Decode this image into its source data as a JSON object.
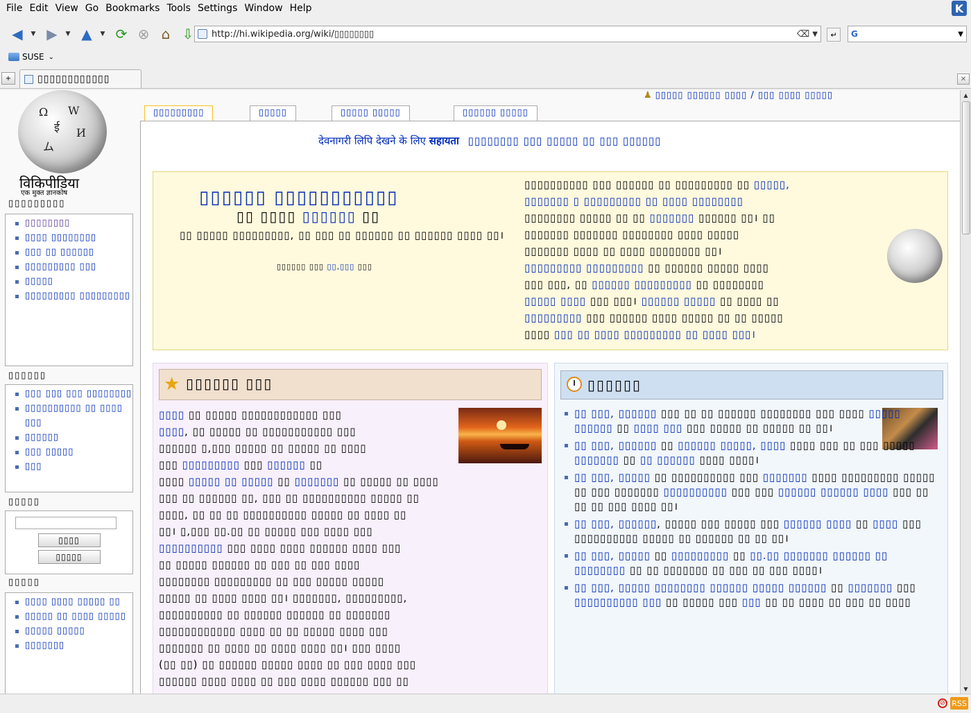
{
  "menubar": {
    "items": [
      "File",
      "Edit",
      "View",
      "Go",
      "Bookmarks",
      "Tools",
      "Settings",
      "Window",
      "Help"
    ],
    "logo_icon": "kde-logo-icon"
  },
  "toolbar": {
    "icons": [
      "back-icon",
      "forward-icon",
      "up-icon",
      "reload-icon",
      "stop-icon",
      "home-icon",
      "download-icon"
    ]
  },
  "address": {
    "url": "http://hi.wikipedia.org/wiki/▯▯▯▯▯▯▯▯"
  },
  "bookmarks": {
    "folder_label": "SUSE"
  },
  "tabs": [
    {
      "label": "▯▯▯▯▯▯▯▯▯▯▯▯"
    }
  ],
  "wiki_logo": {
    "wordmark": "विकिपीडिया",
    "tagline": "एक मुक्त ज्ञानकोष"
  },
  "sidebar": {
    "navigation": {
      "title": "▯▯▯▯▯▯▯▯▯",
      "items": [
        "▯▯▯▯▯▯▯▯",
        "▯▯▯▯ ▯▯▯▯▯▯▯▯",
        "▯▯▯ ▯▯ ▯▯▯▯▯▯",
        "▯▯▯▯▯▯▯▯▯ ▯▯▯",
        "▯▯▯▯▯",
        "▯▯▯▯▯▯▯▯▯ ▯▯▯▯▯▯▯▯▯"
      ]
    },
    "interaction": {
      "title": "▯▯▯▯▯▯",
      "items": [
        "▯▯▯ ▯▯▯ ▯▯▯ ▯▯▯▯▯▯▯▯",
        "▯▯▯▯▯▯▯▯▯▯ ▯▯ ▯▯▯▯ ▯▯▯",
        "▯▯▯▯▯▯",
        "▯▯▯ ▯▯▯▯▯",
        "▯▯▯"
      ]
    },
    "search": {
      "title": "▯▯▯▯▯",
      "go_label": "▯▯▯▯",
      "search_label": "▯▯▯▯▯"
    },
    "toolbox": {
      "title": "▯▯▯▯▯",
      "items": [
        "▯▯▯▯ ▯▯▯▯ ▯▯▯▯▯ ▯▯",
        "▯▯▯▯▯ ▯▯ ▯▯▯▯ ▯▯▯▯▯",
        "▯▯▯▯▯ ▯▯▯▯▯",
        "▯▯▯▯▯▯▯"
      ]
    }
  },
  "personal_tools": {
    "label": "▯▯▯▯▯ ▯▯▯▯▯▯ ▯▯▯▯ / ▯▯▯ ▯▯▯▯ ▯▯▯▯▯"
  },
  "content_tabs": [
    "▯▯▯▯▯▯▯▯▯",
    "▯▯▯▯▯",
    "▯▯▯▯▯ ▯▯▯▯▯",
    "▯▯▯▯▯▯ ▯▯▯▯▯"
  ],
  "help_line": {
    "prefix": "देवनागरी लिपि देखने के लिए",
    "strong": "सहायता",
    "suffix": "▯▯▯▯▯▯▯▯ ▯▯▯ ▯▯▯▯▯ ▯▯ ▯▯▯ ▯▯▯▯▯▯"
  },
  "welcome": {
    "title": "▯▯▯▯▯▯ ▯▯▯▯▯▯▯▯▯▯▯",
    "sub_pre": "▯▯ ▯▯▯▯",
    "sub_link": "▯▯▯▯▯▯",
    "sub_post": "▯▯",
    "description": "▯▯ ▯▯▯▯▯ ▯▯▯▯▯▯▯▯▯, ▯▯ ▯▯▯ ▯▯ ▯▯▯▯▯▯ ▯▯ ▯▯▯▯▯▯ ▯▯▯▯ ▯▯।",
    "stats_pre": "▯▯▯▯▯▯ ▯▯▯",
    "stats_link": "▯▯,▯▯▯",
    "stats_post": "▯▯▯",
    "right_1": "▯▯▯▯▯▯▯▯▯▯ ▯▯▯ ▯▯▯▯▯▯ ▯▯ ▯▯▯▯▯▯▯▯▯ ▯▯",
    "right_1_link": "▯▯▯▯▯,",
    "right_2_link": "▯▯▯▯▯▯▯ ▯ ▯▯▯▯▯▯▯▯▯ ▯▯ ▯▯▯▯ ▯▯▯▯▯▯▯▯",
    "right_3": "▯▯▯▯▯▯▯▯ ▯▯▯▯▯ ▯▯ ▯▯",
    "right_3_link": "▯▯▯▯▯▯▯",
    "right_3_end": "▯▯▯▯▯▯ ▯▯। ▯▯",
    "right_4": "▯▯▯▯▯▯▯ ▯▯▯▯▯▯▯ ▯▯▯▯▯▯▯▯ ▯▯▯▯ ▯▯▯▯▯",
    "right_5": "▯▯▯▯▯▯▯ ▯▯▯▯ ▯▯ ▯▯▯▯ ▯▯▯▯▯▯▯▯ ▯▯।",
    "right_6_link": "▯▯▯▯▯▯▯▯▯ ▯▯▯▯▯▯▯▯▯",
    "right_6": "▯▯ ▯▯▯▯▯▯ ▯▯▯▯▯ ▯▯▯▯",
    "right_7": "▯▯▯ ▯▯▯, ▯▯",
    "right_7_link": "▯▯▯▯▯▯ ▯▯▯▯▯▯▯▯▯",
    "right_7_end": "▯▯ ▯▯▯▯▯▯▯▯",
    "right_8_link": "▯▯▯▯▯ ▯▯▯▯",
    "right_8": "▯▯▯ ▯▯▯।",
    "right_8_link2": "▯▯▯▯▯▯ ▯▯▯▯▯",
    "right_8_end": "▯▯ ▯▯▯▯ ▯▯",
    "right_9_link": "▯▯▯▯▯▯▯▯▯",
    "right_9": "▯▯▯ ▯▯▯▯▯▯ ▯▯▯▯ ▯▯▯▯▯ ▯▯ ▯▯ ▯▯▯▯▯",
    "right_10": "▯▯▯▯",
    "right_10_link": "▯▯▯ ▯▯ ▯▯▯▯ ▯▯▯▯▯▯▯▯▯ ▯▯ ▯▯▯▯ ▯▯▯।"
  },
  "featured": {
    "title": "▯▯▯▯▯▯ ▯▯▯",
    "lines": [
      [
        "l",
        "▯▯▯▯",
        "t",
        " ▯▯ ▯▯▯▯▯ ▯▯▯▯▯▯▯▯▯▯▯▯ ▯▯▯"
      ],
      [
        "l",
        "▯▯▯▯",
        "t",
        ", ▯▯ ▯▯▯▯▯ ▯▯ ▯▯▯▯▯▯▯▯▯▯▯ ▯▯▯"
      ],
      [
        "t",
        "▯▯▯▯▯▯ ▯,▯▯▯ ▯▯▯▯▯ ▯▯ ▯▯▯▯▯ ▯▯ ▯▯▯▯"
      ],
      [
        "t",
        "▯▯▯ ",
        "l",
        "▯▯▯▯▯▯▯▯▯",
        "t",
        " ▯▯▯ ",
        "l",
        "▯▯▯▯▯▯",
        "t",
        " ▯▯"
      ],
      [
        "t",
        "▯▯▯▯ ",
        "l",
        "▯▯▯▯▯ ▯▯ ▯▯▯▯▯",
        "t",
        " ▯▯ ",
        "l",
        "▯▯▯▯▯▯▯",
        "t",
        " ▯▯ ▯▯▯▯▯ ▯▯ ▯▯▯▯"
      ],
      [
        "t",
        "▯▯▯ ▯▯ ▯▯▯▯▯▯ ▯▯, ▯▯▯ ▯▯ ▯▯▯▯▯▯▯▯▯▯ ▯▯▯▯▯ ▯▯"
      ],
      [
        "t",
        "▯▯▯▯, ▯▯ ▯▯ ▯▯ ▯▯▯▯▯▯▯▯▯▯ ▯▯▯▯▯ ▯▯ ▯▯▯▯ ▯▯"
      ],
      [
        "t",
        "▯▯। ▯,▯▯▯ ▯▯.▯▯ ▯▯ ▯▯▯▯▯ ▯▯▯ ▯▯▯▯ ▯▯▯"
      ],
      [
        "l",
        "▯▯▯▯▯▯▯▯▯▯",
        "t",
        " ▯▯▯ ▯▯▯▯ ▯▯▯▯ ▯▯▯▯▯▯ ▯▯▯▯ ▯▯▯"
      ],
      [
        "t",
        "▯▯ ▯▯▯▯▯ ▯▯▯▯▯▯ ▯▯ ▯▯▯ ▯▯ ▯▯▯ ▯▯▯▯"
      ],
      [
        "t",
        "▯▯▯▯▯▯▯▯ ▯▯▯▯▯▯▯▯▯ ▯▯ ▯▯▯ ▯▯▯▯▯ ▯▯▯▯▯"
      ],
      [
        "t",
        "▯▯▯▯▯ ▯▯ ▯▯▯▯ ▯▯▯▯ ▯▯। ▯▯▯▯▯▯▯, ▯▯▯▯▯▯▯▯▯,"
      ],
      [
        "t",
        "▯▯▯▯▯▯▯▯▯▯ ▯▯ ▯▯▯▯▯▯ ▯▯▯▯▯▯ ▯▯ ▯▯▯▯▯▯▯"
      ],
      [
        "t",
        "▯▯▯▯▯▯▯▯▯▯▯▯ ▯▯▯▯ ▯▯ ▯▯ ▯▯▯▯▯ ▯▯▯▯ ▯▯▯"
      ],
      [
        "t",
        "▯▯▯▯▯▯▯ ▯▯ ▯▯▯▯ ▯▯ ▯▯▯▯ ▯▯▯▯ ▯▯। ▯▯▯ ▯▯▯▯"
      ],
      [
        "t",
        "(▯▯ ▯▯) ▯▯ ▯▯▯▯▯▯ ▯▯▯▯▯ ▯▯▯▯ ▯▯ ▯▯▯ ▯▯▯▯ ▯▯▯"
      ],
      [
        "t",
        "▯▯▯▯▯▯ ▯▯▯▯ ▯▯▯▯ ▯▯ ▯▯▯ ▯▯▯▯ ▯▯▯▯▯▯ ▯▯▯ ▯▯"
      ]
    ]
  },
  "events": {
    "title": "▯▯▯▯▯▯",
    "items": [
      [
        [
          "l",
          "▯▯ ▯▯▯, ▯▯▯▯▯▯"
        ],
        [
          "t",
          " ▯▯▯ ▯▯ ▯▯ ▯▯▯▯▯▯ ▯▯▯▯▯▯▯▯ ▯▯▯ ▯▯▯▯ "
        ],
        [
          "l",
          "▯▯▯▯▯ ▯▯▯▯▯▯"
        ],
        [
          "t",
          " ▯▯ "
        ],
        [
          "l",
          "▯▯▯▯ ▯▯▯"
        ],
        [
          "t",
          " ▯▯▯ ▯▯▯▯▯ ▯▯ ▯▯▯▯▯ ▯▯ ▯▯।"
        ]
      ],
      [
        [
          "l",
          "▯▯ ▯▯▯, ▯▯▯▯▯▯"
        ],
        [
          "t",
          " ▯▯ "
        ],
        [
          "l",
          "▯▯▯▯▯▯ ▯▯▯▯▯, ▯▯▯▯"
        ],
        [
          "t",
          " ▯▯▯▯ ▯▯▯ ▯▯ ▯▯▯ ▯▯▯▯▯ "
        ],
        [
          "l",
          "▯▯▯▯▯▯▯"
        ],
        [
          "t",
          " ▯▯ "
        ],
        [
          "l",
          "▯▯ ▯▯▯▯▯▯"
        ],
        [
          "t",
          " ▯▯▯▯ ▯▯▯▯।"
        ]
      ],
      [
        [
          "l",
          "▯▯ ▯▯▯, ▯▯▯▯▯"
        ],
        [
          "t",
          " ▯▯ ▯▯▯▯▯▯▯▯▯▯ ▯▯▯ "
        ],
        [
          "l",
          "▯▯▯▯▯▯▯"
        ],
        [
          "t",
          " ▯▯▯▯ ▯▯▯▯▯▯▯▯▯ ▯▯▯▯▯ ▯▯ ▯▯▯ ▯▯▯▯▯▯▯ "
        ],
        [
          "l",
          "▯▯▯▯▯▯▯▯▯▯"
        ],
        [
          "t",
          " ▯▯▯ ▯▯▯ "
        ],
        [
          "l",
          "▯▯▯▯▯▯ ▯▯▯▯▯▯ ▯▯▯▯"
        ],
        [
          "t",
          " ▯▯▯ ▯▯ ▯▯ ▯▯ ▯▯▯ ▯▯▯▯ ▯▯।"
        ]
      ],
      [
        [
          "l",
          "▯▯ ▯▯▯, ▯▯▯▯▯▯"
        ],
        [
          "t",
          ", ▯▯▯▯▯ ▯▯▯ ▯▯▯▯▯ ▯▯▯ "
        ],
        [
          "l",
          "▯▯▯▯▯▯ ▯▯▯▯"
        ],
        [
          "t",
          " ▯▯ "
        ],
        [
          "l",
          "▯▯▯▯"
        ],
        [
          "t",
          " ▯▯▯ ▯▯▯▯▯▯▯▯▯▯ ▯▯▯▯▯ ▯▯ ▯▯▯▯▯▯ ▯▯ ▯▯ ▯▯।"
        ]
      ],
      [
        [
          "l",
          "▯▯ ▯▯▯, ▯▯▯▯▯"
        ],
        [
          "t",
          " ▯▯ "
        ],
        [
          "l",
          "▯▯▯▯▯▯▯▯▯"
        ],
        [
          "t",
          " ▯▯ "
        ],
        [
          "l",
          "▯▯.▯▯ ▯▯▯▯▯▯▯ ▯▯▯▯▯▯ ▯▯ ▯▯▯▯▯▯▯▯"
        ],
        [
          "t",
          " ▯▯ ▯▯ ▯▯▯▯▯▯▯ ▯▯ ▯▯▯ ▯▯ ▯▯▯ ▯▯▯▯।"
        ]
      ],
      [
        [
          "l",
          "▯▯ ▯▯▯, ▯▯▯▯▯ ▯▯▯▯▯▯▯▯ ▯▯▯▯▯▯ ▯▯▯▯▯ ▯▯▯▯▯▯"
        ],
        [
          "t",
          " ▯▯ "
        ],
        [
          "l",
          "▯▯▯▯▯▯▯"
        ],
        [
          "t",
          " ▯▯▯ "
        ],
        [
          "l",
          "▯▯▯▯▯▯▯▯▯▯ ▯▯▯"
        ],
        [
          "t",
          " ▯▯ ▯▯▯▯▯ ▯▯▯ "
        ],
        [
          "l",
          "▯▯▯"
        ],
        [
          "t",
          " ▯▯ ▯▯ ▯▯▯▯ ▯▯ ▯▯▯ ▯▯ ▯▯▯▯"
        ]
      ]
    ]
  },
  "colors": {
    "link": "#002bb8",
    "visited": "#5a3696",
    "welcome_bg": "#fffadd",
    "featured_bg": "#f8f0fb",
    "events_bg": "#f2f7fc"
  }
}
